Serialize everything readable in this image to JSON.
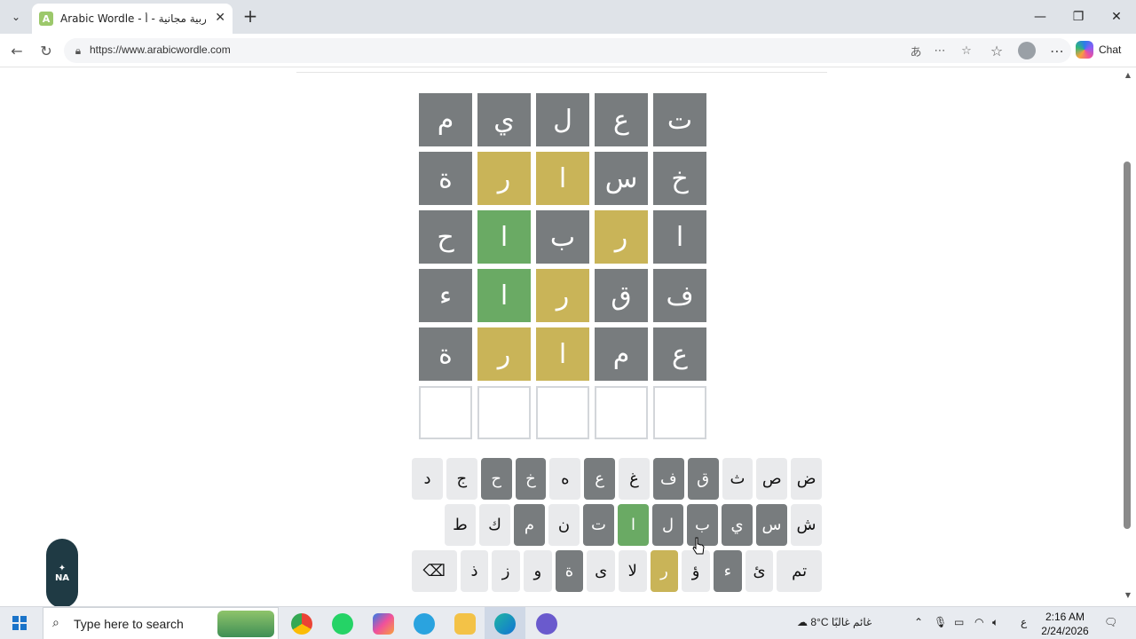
{
  "browser": {
    "tab_title": "Arabic Wordle - وردل عربية مجانية - أ",
    "tab_favicon": "A",
    "url": "https://www.arabicwordle.com",
    "chat_label": "Chat"
  },
  "board": {
    "rows": [
      {
        "letters": [
          "ت",
          "ع",
          "ل",
          "ي",
          "م"
        ],
        "states": [
          "absent",
          "absent",
          "absent",
          "absent",
          "absent"
        ]
      },
      {
        "letters": [
          "خ",
          "س",
          "ا",
          "ر",
          "ة"
        ],
        "states": [
          "absent",
          "absent",
          "present",
          "present",
          "absent"
        ]
      },
      {
        "letters": [
          "ا",
          "ر",
          "ب",
          "ا",
          "ح"
        ],
        "states": [
          "absent",
          "present",
          "absent",
          "correct",
          "absent"
        ]
      },
      {
        "letters": [
          "ف",
          "ق",
          "ر",
          "ا",
          "ء"
        ],
        "states": [
          "absent",
          "absent",
          "present",
          "correct",
          "absent"
        ]
      },
      {
        "letters": [
          "ع",
          "م",
          "ا",
          "ر",
          "ة"
        ],
        "states": [
          "absent",
          "absent",
          "present",
          "present",
          "absent"
        ]
      },
      {
        "letters": [
          "",
          "",
          "",
          "",
          ""
        ],
        "states": [
          "empty",
          "empty",
          "empty",
          "empty",
          "empty"
        ]
      }
    ]
  },
  "keyboard": {
    "rows": [
      [
        {
          "label": "ض",
          "state": ""
        },
        {
          "label": "ص",
          "state": ""
        },
        {
          "label": "ث",
          "state": ""
        },
        {
          "label": "ق",
          "state": "absent"
        },
        {
          "label": "ف",
          "state": "absent"
        },
        {
          "label": "غ",
          "state": ""
        },
        {
          "label": "ع",
          "state": "absent"
        },
        {
          "label": "ه",
          "state": ""
        },
        {
          "label": "خ",
          "state": "absent"
        },
        {
          "label": "ح",
          "state": "absent"
        },
        {
          "label": "ج",
          "state": ""
        },
        {
          "label": "د",
          "state": ""
        }
      ],
      [
        {
          "label": "ش",
          "state": ""
        },
        {
          "label": "س",
          "state": "absent"
        },
        {
          "label": "ي",
          "state": "absent"
        },
        {
          "label": "ب",
          "state": "absent"
        },
        {
          "label": "ل",
          "state": "absent"
        },
        {
          "label": "ا",
          "state": "correct"
        },
        {
          "label": "ت",
          "state": "absent"
        },
        {
          "label": "ن",
          "state": ""
        },
        {
          "label": "م",
          "state": "absent"
        },
        {
          "label": "ك",
          "state": ""
        },
        {
          "label": "ط",
          "state": ""
        }
      ],
      [
        {
          "label": "تم",
          "state": "",
          "wide": true
        },
        {
          "label": "ئ",
          "state": ""
        },
        {
          "label": "ء",
          "state": "absent"
        },
        {
          "label": "ؤ",
          "state": ""
        },
        {
          "label": "ر",
          "state": "present"
        },
        {
          "label": "لا",
          "state": ""
        },
        {
          "label": "ى",
          "state": ""
        },
        {
          "label": "ة",
          "state": "absent"
        },
        {
          "label": "و",
          "state": ""
        },
        {
          "label": "ز",
          "state": ""
        },
        {
          "label": "ذ",
          "state": ""
        },
        {
          "label": "⌫",
          "state": "",
          "wide": true
        }
      ]
    ]
  },
  "taskbar": {
    "search_placeholder": "Type here to search",
    "weather": "8°C  غائم غالبًا",
    "lang": "ع",
    "time": "2:16 AM",
    "date": "2/24/2026"
  },
  "colors": {
    "absent": "#787c7e",
    "present": "#c9b458",
    "correct": "#6aaa64"
  }
}
